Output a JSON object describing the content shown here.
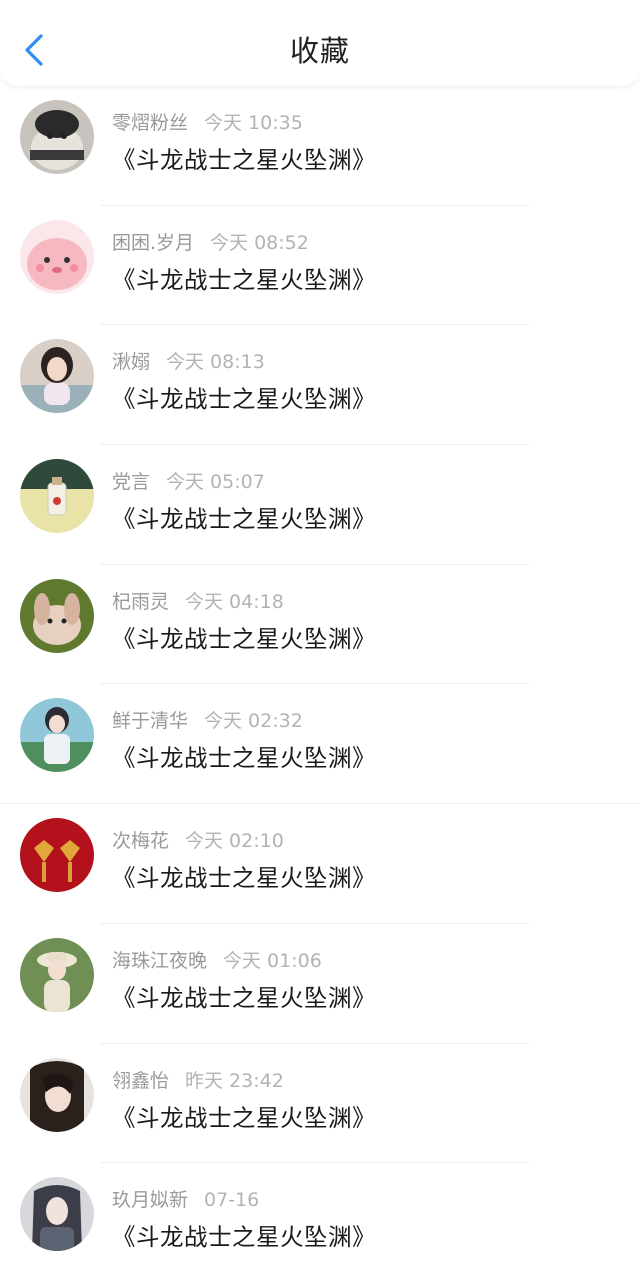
{
  "header": {
    "title": "收藏",
    "back_icon": "chevron-left-icon",
    "accent_color": "#2f8cf0"
  },
  "items": [
    {
      "name": "零熠粉丝",
      "time": "今天 10:35",
      "content": "《斗龙战士之星火坠渊》"
    },
    {
      "name": "困困.岁月",
      "time": "今天 08:52",
      "content": "《斗龙战士之星火坠渊》"
    },
    {
      "name": "湫嫋",
      "time": "今天 08:13",
      "content": "《斗龙战士之星火坠渊》"
    },
    {
      "name": "党言",
      "time": "今天 05:07",
      "content": "《斗龙战士之星火坠渊》"
    },
    {
      "name": "杞雨灵",
      "time": "今天 04:18",
      "content": "《斗龙战士之星火坠渊》"
    },
    {
      "name": "鲜于清华",
      "time": "今天 02:32",
      "content": "《斗龙战士之星火坠渊》"
    },
    {
      "name": "次梅花",
      "time": "今天 02:10",
      "content": "《斗龙战士之星火坠渊》"
    },
    {
      "name": "海珠江夜晚",
      "time": "今天 01:06",
      "content": "《斗龙战士之星火坠渊》"
    },
    {
      "name": "翎鑫怡",
      "time": "昨天 23:42",
      "content": "《斗龙战士之星火坠渊》"
    },
    {
      "name": "玖月姒新",
      "time": "07-16",
      "content": "《斗龙战士之星火坠渊》"
    }
  ]
}
